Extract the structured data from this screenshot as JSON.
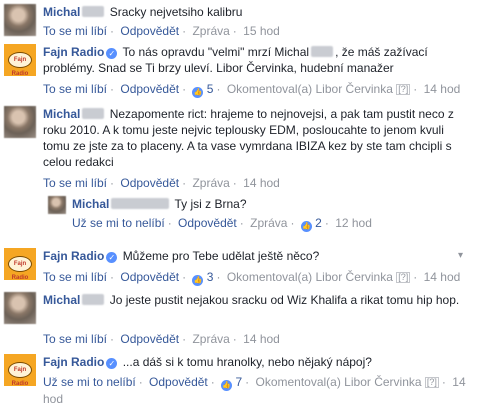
{
  "comments": [
    {
      "author": "Michal",
      "text": "Sracky nejvetsiho kalibru",
      "actions": {
        "like": "To se mi líbí",
        "reply": "Odpovědět",
        "message": "Zpráva",
        "time": "15 hod"
      }
    },
    {
      "author": "Fajn Radio",
      "verified": true,
      "text_prefix": "To nás opravdu \"velmi\" mrzí Michal",
      "text_suffix": ", že máš zažívací problémy. Snad se Ti brzy uleví. Libor Červinka, hudební manažer",
      "actions": {
        "like": "To se mi líbí",
        "reply": "Odpovědět",
        "reactions": "5",
        "commented_by": "Okomentoval(a) Libor Červinka",
        "qm": "[?]",
        "time": "14 hod"
      }
    },
    {
      "author": "Michal",
      "text": "Nezapomente rict: hrajeme to nejnovejsi, a pak tam pustit neco z roku 2010. A k tomu jeste nejvic teplousky EDM, posloucahte to jenom kvuli tomu ze jste za to placeny. A ta vase vymrdana IBIZA kez by ste tam chcipli s celou redakci",
      "actions": {
        "like": "To se mi líbí",
        "reply": "Odpovědět",
        "message": "Zpráva",
        "time": "14 hod"
      },
      "reply": {
        "author": "Michal",
        "text": "Ty jsi z Brna?",
        "actions": {
          "unlike": "Už se mi to nelíbí",
          "reply": "Odpovědět",
          "message": "Zpráva",
          "reactions": "2",
          "time": "12 hod"
        }
      }
    },
    {
      "author": "Fajn Radio",
      "verified": true,
      "text": "Můžeme pro Tebe udělat ještě něco?",
      "actions": {
        "like": "To se mi líbí",
        "reply": "Odpovědět",
        "reactions": "3",
        "commented_by": "Okomentoval(a) Libor Červinka",
        "qm": "[?]",
        "time": "14 hod"
      }
    },
    {
      "author": "Michal",
      "text": "Jo jeste pustit nejakou sracku od Wiz Khalifa a rikat tomu hip hop.",
      "actions": {
        "like": "To se mi líbí",
        "reply": "Odpovědět",
        "message": "Zpráva",
        "time": "14 hod"
      }
    },
    {
      "author": "Fajn Radio",
      "verified": true,
      "text": "...a dáš si k tomu hranolky, nebo nějaký nápoj?",
      "actions": {
        "unlike": "Už se mi to nelíbí",
        "reply": "Odpovědět",
        "reactions": "7",
        "commented_by": "Okomentoval(a) Libor Červinka",
        "qm": "[?]",
        "time": "14 hod"
      }
    }
  ],
  "logo_text": "Fajn Radio",
  "colors": {
    "link": "#365899",
    "muted": "#90949c",
    "accent": "#5890ff",
    "logo": "#f5a623"
  }
}
